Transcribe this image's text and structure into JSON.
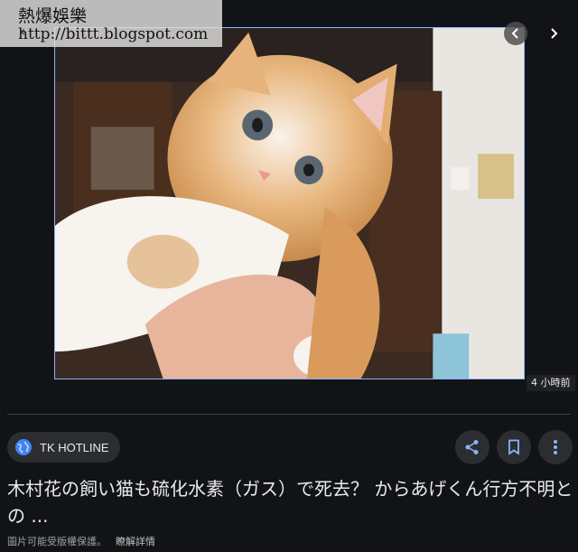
{
  "watermark": {
    "title": "熱爆娛樂",
    "url": "http://bittt.blogspot.com",
    "back_glyph": "‹"
  },
  "nav": {
    "prev_icon": "chevron-left-icon",
    "next_icon": "chevron-right-icon"
  },
  "image": {
    "subject": "kitten-photo"
  },
  "time_badge": "4 小時前",
  "source": {
    "name": "TK HOTLINE",
    "icon": "globe-icon"
  },
  "actions": {
    "share_icon": "share-icon",
    "save_icon": "bookmark-icon",
    "more_icon": "more-vert-icon"
  },
  "headline": "木村花の飼い猫も硫化水素（ガス）で死去？ からあげくん行方不明との ...",
  "copyright": {
    "notice": "圖片可能受版權保護。",
    "learn_more": "瞭解詳情"
  },
  "colors": {
    "background": "#121316",
    "accent_border": "#8ab4f8",
    "chip": "#2b2d31",
    "globe": "#4285f4"
  }
}
